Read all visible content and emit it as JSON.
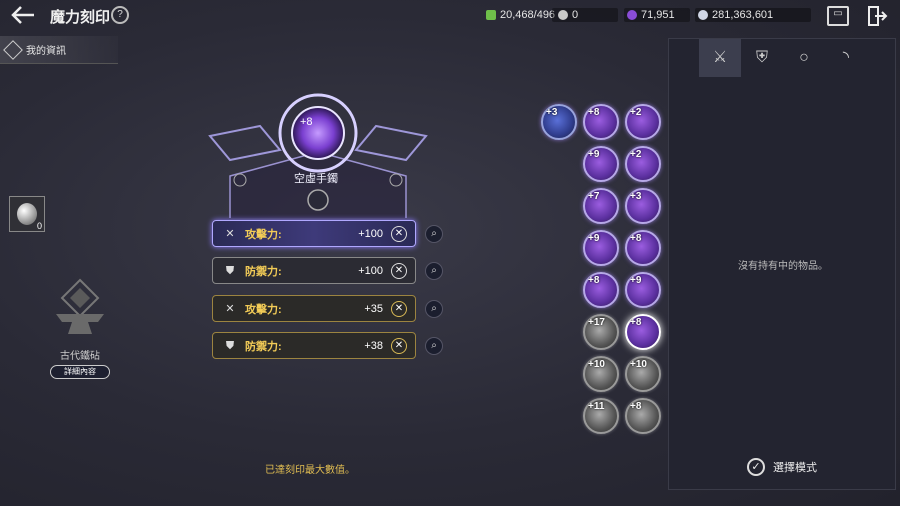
{
  "header": {
    "back_icon": "arrow-left-icon",
    "title": "魔力刻印",
    "help_icon": "book-help-icon",
    "currencies": [
      {
        "icon": "green-gem-icon",
        "value": "20,468/496",
        "color": "#6fbf4a"
      },
      {
        "icon": "silver-coin-icon",
        "value": "0",
        "color": "#c9c9c9"
      },
      {
        "icon": "purple-crystal-icon",
        "value": "71,951",
        "color": "#8a4dd6"
      },
      {
        "icon": "silver-orb-icon",
        "value": "281,363,601",
        "color": "#d0d6e6"
      }
    ],
    "mail_icon": "mailbox-icon",
    "exit_icon": "exit-door-icon"
  },
  "sidebar": {
    "info_tab_label": "我的資訊",
    "stone_count": "0",
    "anvil_label": "古代鐵砧",
    "detail_button": "詳細內容"
  },
  "emblem": {
    "level": "+8",
    "name": "空虛手鐲"
  },
  "stats": [
    {
      "name": "攻擊力:",
      "value": "+100",
      "icon": "crossed-swords-icon"
    },
    {
      "name": "防禦力:",
      "value": "+100",
      "icon": "shield-icon"
    },
    {
      "name": "攻擊力:",
      "value": "+35",
      "icon": "crossed-swords-icon"
    },
    {
      "name": "防禦力:",
      "value": "+38",
      "icon": "shield-icon"
    }
  ],
  "max_message": "已達刻印最大數值。",
  "inventory": {
    "equipped_level": "+3",
    "items": [
      {
        "level": "+8",
        "type": "purple"
      },
      {
        "level": "+2",
        "type": "purple"
      },
      {
        "level": "+9",
        "type": "purple"
      },
      {
        "level": "+2",
        "type": "purple"
      },
      {
        "level": "+7",
        "type": "purple"
      },
      {
        "level": "+3",
        "type": "purple"
      },
      {
        "level": "+9",
        "type": "purple"
      },
      {
        "level": "+8",
        "type": "purple"
      },
      {
        "level": "+8",
        "type": "purple"
      },
      {
        "level": "+9",
        "type": "purple"
      },
      {
        "level": "+17",
        "type": "gray"
      },
      {
        "level": "+8",
        "type": "glow"
      },
      {
        "level": "+10",
        "type": "gray"
      },
      {
        "level": "+10",
        "type": "gray"
      },
      {
        "level": "+11",
        "type": "gray"
      },
      {
        "level": "+8",
        "type": "gray"
      }
    ]
  },
  "panel": {
    "tabs": [
      "crossed-swords-icon",
      "armor-icon",
      "ring-icon",
      "bracelet-icon"
    ],
    "empty_message": "沒有持有中的物品。",
    "select_mode_label": "選擇模式",
    "check_icon": "checkmark-circle-icon"
  },
  "colors": {
    "accent_gold": "#f3cc57",
    "glow_purple": "#a98cff",
    "panel_bg": "#232430"
  }
}
